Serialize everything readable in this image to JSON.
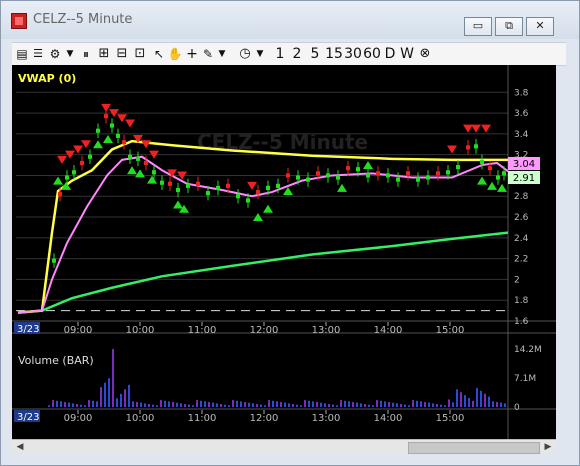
{
  "window": {
    "title": "CELZ--5 Minute",
    "buttons": {
      "minimize": "▭",
      "restore": "⧉",
      "close": "✕"
    }
  },
  "toolbar": {
    "timeframes": [
      "1",
      "2",
      "5",
      "15",
      "30",
      "60",
      "D",
      "W"
    ],
    "icons": [
      "print-icon",
      "toolbar-menu-icon",
      "gear-icon",
      "dropdown-icon",
      "pause-icon",
      "grid-icon",
      "layout-icon",
      "add-window-icon",
      "cursor-icon",
      "hand-icon",
      "crosshair-icon",
      "pencil-icon",
      "dropdown-icon",
      "clock-icon",
      "dropdown-icon",
      "close-icon"
    ]
  },
  "price_pane": {
    "indicator_label": "VWAP (0)",
    "watermark": "CELZ--5 Minute",
    "y_ticks": [
      "3.8",
      "3.6",
      "3.4",
      "3.2",
      "3",
      "2.8",
      "2.6",
      "2.4",
      "2.2",
      "2",
      "1.8",
      "1.6"
    ],
    "last_price_tag": "3.04",
    "vwap_tag": "2.91",
    "colors": {
      "vwap": "#ffff44",
      "ema": "#ff88ff",
      "slow_ma": "#33ee66",
      "up": "#22dd22",
      "down": "#ee2222",
      "grid": "#333333",
      "background": "#000000"
    }
  },
  "volume_pane": {
    "label": "Volume (BAR)",
    "y_ticks": [
      "14.2M",
      "7.1M",
      "0"
    ]
  },
  "time_axis": {
    "date_label": "3/23",
    "ticks": [
      "09:00",
      "10:00",
      "11:00",
      "12:00",
      "13:00",
      "14:00",
      "15:00"
    ]
  },
  "chart_data": {
    "type": "line",
    "title": "CELZ--5 Minute",
    "ylim": [
      1.6,
      3.9
    ],
    "x": [
      "09:00",
      "09:30",
      "10:00",
      "10:30",
      "11:00",
      "11:30",
      "12:00",
      "12:30",
      "13:00",
      "13:30",
      "14:00",
      "14:30",
      "15:00",
      "15:30"
    ],
    "series": [
      {
        "name": "VWAP (0)",
        "values": [
          2.7,
          3.2,
          3.34,
          3.3,
          3.26,
          3.23,
          3.2,
          3.19,
          3.18,
          3.17,
          3.16,
          3.15,
          3.15,
          3.15
        ]
      },
      {
        "name": "price",
        "values": [
          2.8,
          3.35,
          3.2,
          3.02,
          2.95,
          2.92,
          2.78,
          2.9,
          2.97,
          3.0,
          3.0,
          3.0,
          3.05,
          3.04
        ]
      }
    ],
    "volume": {
      "ylim": [
        0,
        14.2
      ],
      "unit": "M",
      "peak_time": "09:30",
      "peak_value": 14.2
    }
  }
}
